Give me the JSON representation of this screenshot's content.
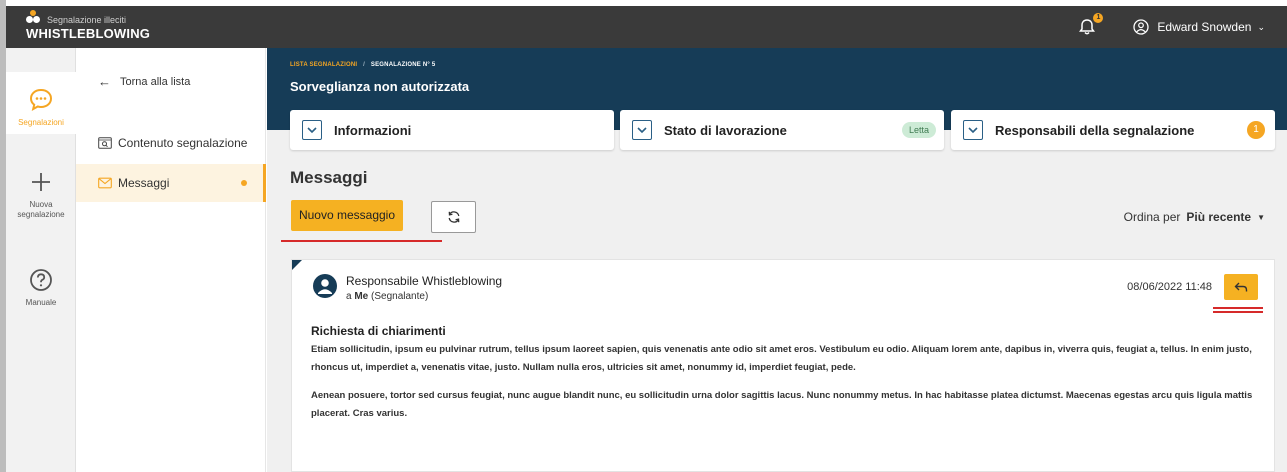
{
  "app": {
    "brand_sub": "Segnalazione illeciti",
    "brand_main": "WHISTLEBLOWING",
    "notifications_count": "1",
    "user_name": "Edward Snowden"
  },
  "rail": {
    "items": [
      {
        "label": "Segnalazioni",
        "icon": "chat-bubble-icon"
      },
      {
        "label": "Nuova segnalazione",
        "icon": "plus-icon"
      },
      {
        "label": "Manuale",
        "icon": "help-icon"
      }
    ]
  },
  "sidebar": {
    "back_label": "Torna alla lista",
    "items": [
      {
        "label": "Contenuto segnalazione",
        "icon": "search-document-icon"
      },
      {
        "label": "Messaggi",
        "icon": "envelope-icon"
      }
    ]
  },
  "header": {
    "breadcrumb": [
      "LISTA SEGNALAZIONI",
      "/",
      "SEGNALAZIONE N° 5"
    ],
    "title": "Sorveglianza non autorizzata"
  },
  "panels": [
    {
      "title": "Informazioni"
    },
    {
      "title": "Stato di lavorazione",
      "badge": "Letta"
    },
    {
      "title": "Responsabili della segnalazione",
      "badge": "1"
    }
  ],
  "messages_section": {
    "title": "Messaggi",
    "new_button": "Nuovo messaggio",
    "sort_label": "Ordina per",
    "sort_value": "Più recente"
  },
  "message": {
    "sender": "Responsabile Whistleblowing",
    "to_prefix": "a",
    "to_name": "Me",
    "to_role": "(Segnalante)",
    "date": "08/06/2022 11:48",
    "subject": "Richiesta di chiarimenti",
    "paragraphs": [
      "Etiam sollicitudin, ipsum eu pulvinar rutrum, tellus ipsum laoreet sapien, quis venenatis ante odio sit amet eros. Vestibulum eu odio. Aliquam lorem ante, dapibus in, viverra quis, feugiat a, tellus. In enim justo, rhoncus ut, imperdiet a, venenatis vitae, justo. Nullam nulla eros, ultricies sit amet, nonummy id, imperdiet feugiat, pede.",
      "Aenean posuere, tortor sed cursus feugiat, nunc augue blandit nunc, eu sollicitudin urna dolor sagittis lacus. Nunc nonummy metus. In hac habitasse platea dictumst. Maecenas egestas arcu quis ligula mattis placerat. Cras varius."
    ]
  },
  "colors": {
    "accent": "#f5b122",
    "header_bg": "#163c57",
    "topbar_bg": "#3a3a3a",
    "highlight_red": "#d62a2a"
  }
}
